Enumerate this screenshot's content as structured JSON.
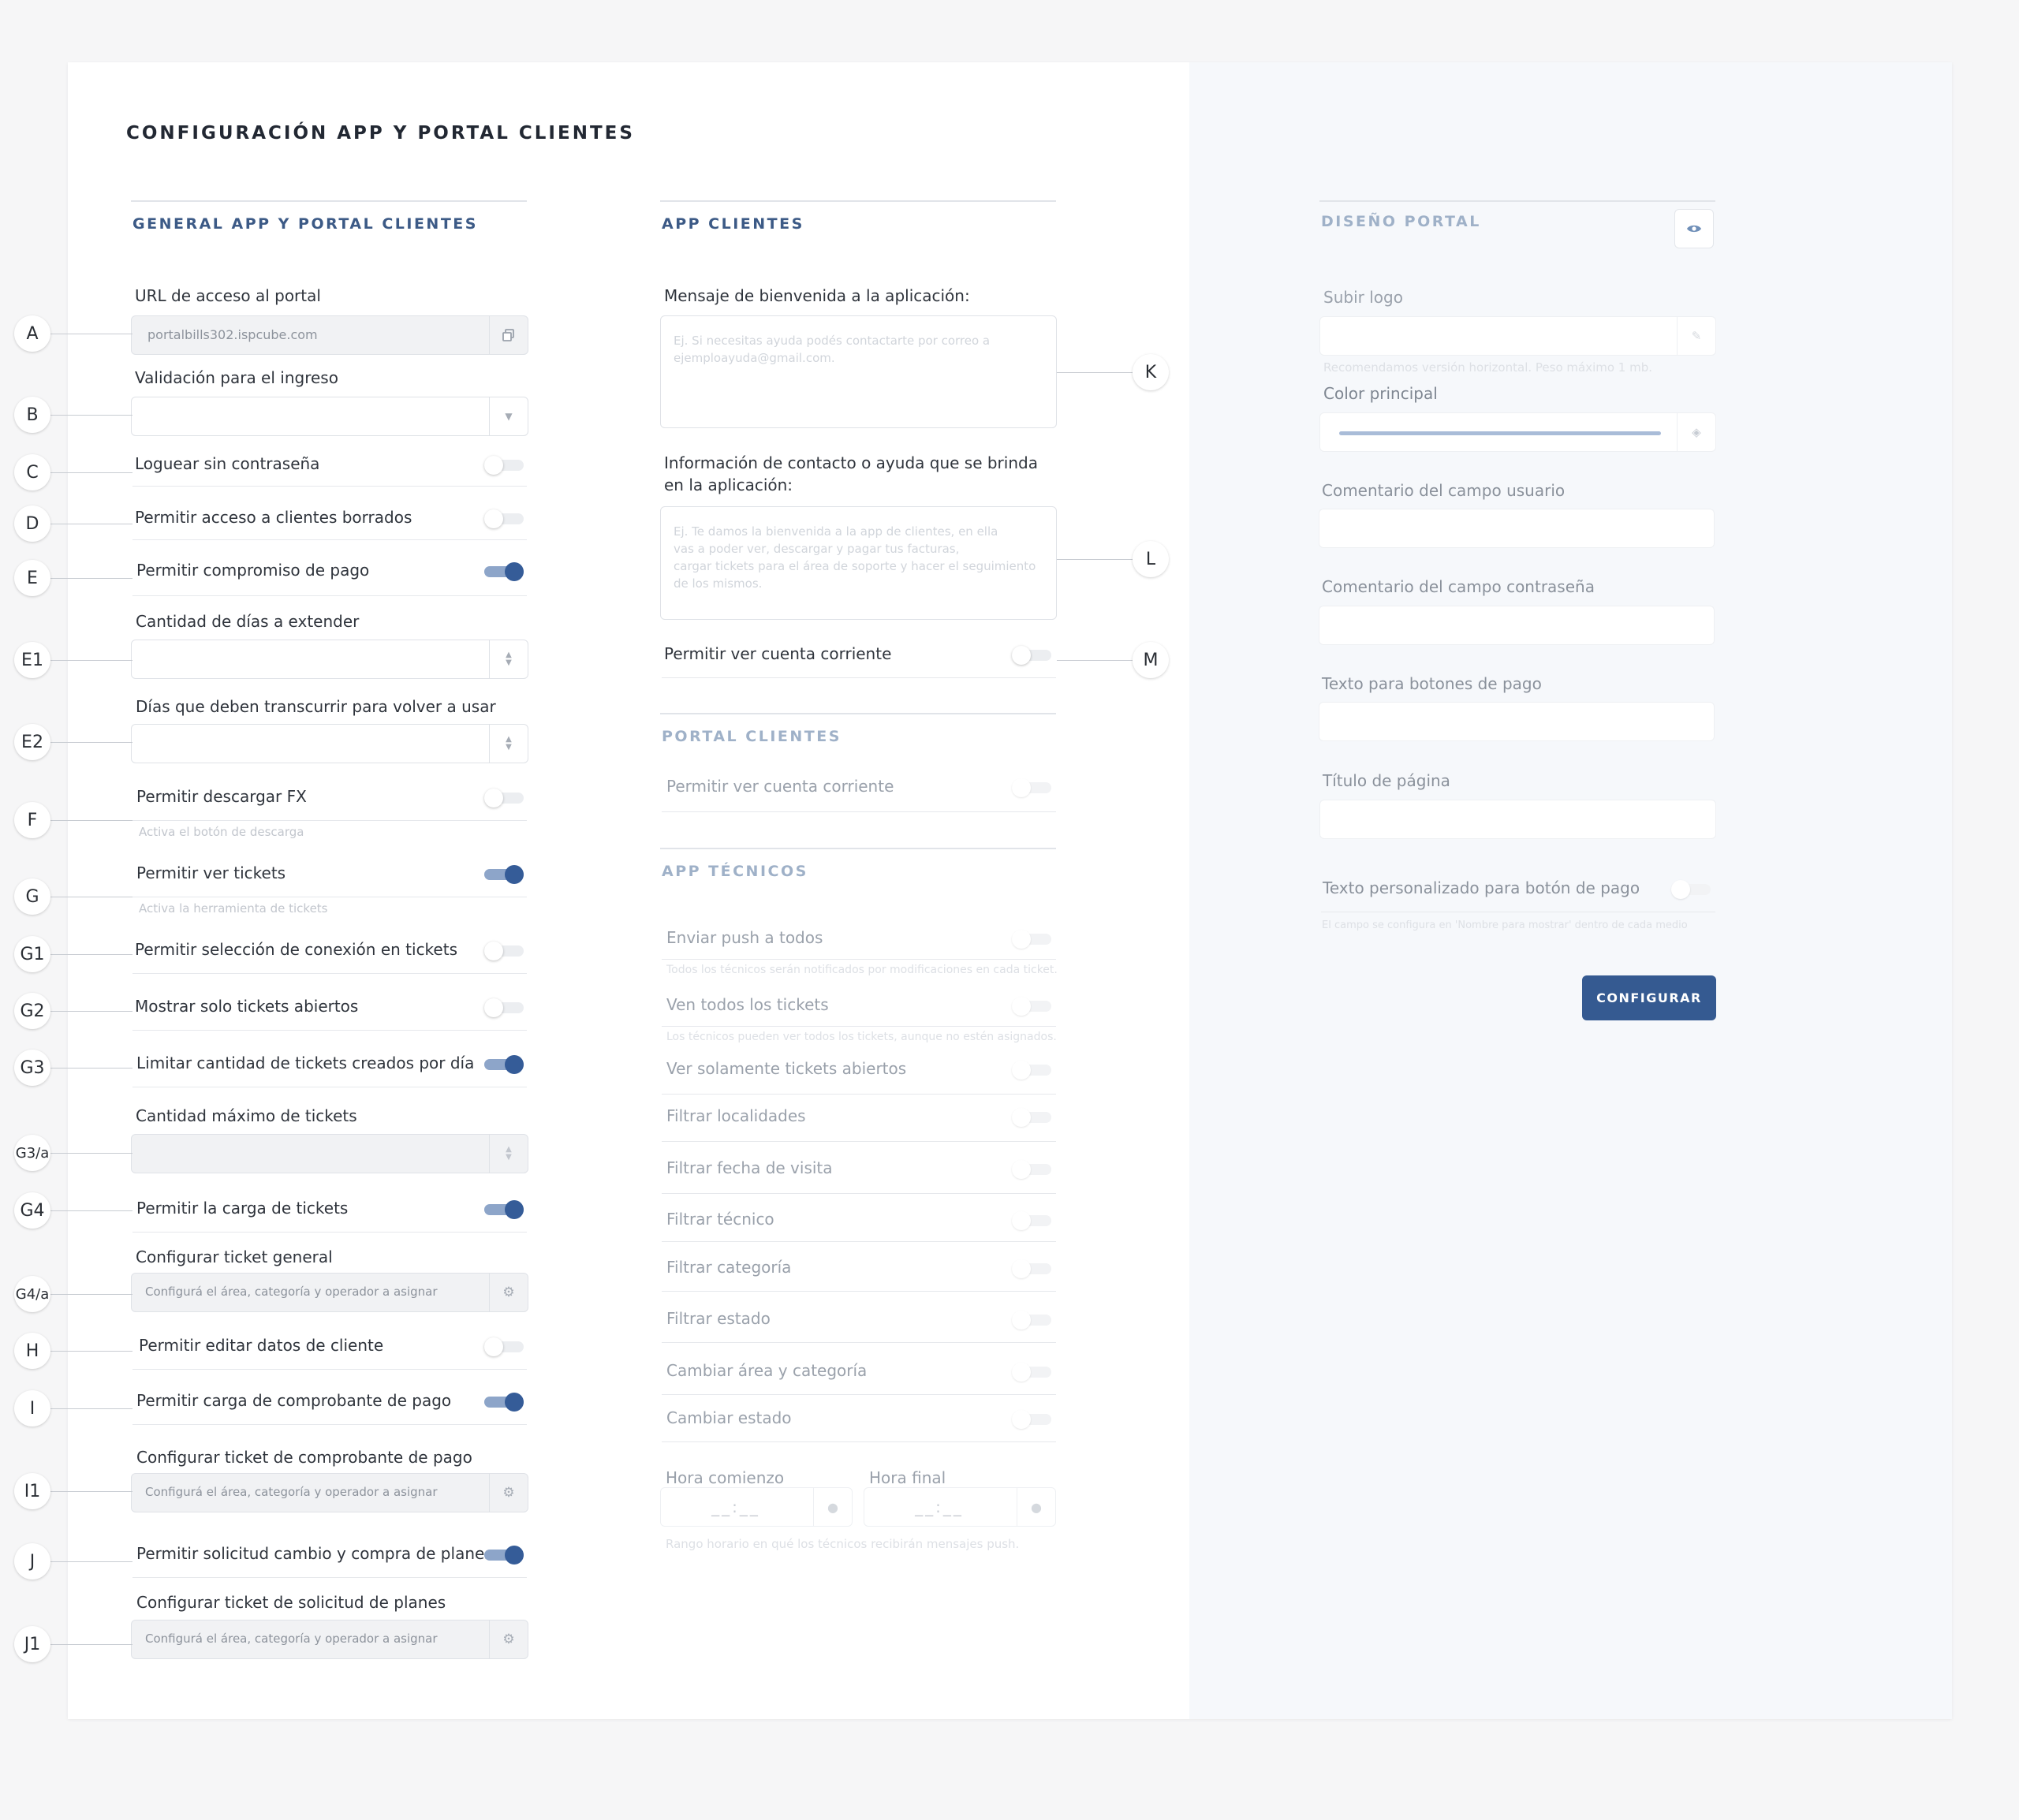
{
  "page": {
    "title": "CONFIGURACIÓN APP Y PORTAL CLIENTES"
  },
  "general": {
    "title": "GENERAL APP Y PORTAL CLIENTES",
    "url_label": "URL de acceso al portal",
    "url_value": "portalbills302.ispcube.com",
    "validation_label": "Validación para el ingreso",
    "validation_value": "",
    "login_no_pass": "Loguear sin contraseña",
    "allow_deleted": "Permitir acceso a clientes borrados",
    "allow_payment_commit": "Permitir compromiso de pago",
    "days_extend_label": "Cantidad de días a extender",
    "days_reuse_label": "Días que deben transcurrir para volver a usar",
    "allow_fx": "Permitir descargar FX",
    "allow_fx_help": "Activa el botón de descarga",
    "allow_tickets": "Permitir ver tickets",
    "allow_tickets_help": "Activa la herramienta de tickets",
    "allow_conn_select": "Permitir selección de conexión en tickets",
    "only_open": "Mostrar solo tickets abiertos",
    "limit_tickets": "Limitar cantidad de tickets creados por día",
    "max_tickets_label": "Cantidad máximo de tickets",
    "allow_ticket_upload": "Permitir la carga de tickets",
    "config_general_ticket": "Configurar ticket general",
    "config_placeholder": "Configurá el área, categoría y operador a asignar",
    "allow_edit_client": "Permitir editar datos de cliente",
    "allow_receipt_upload": "Permitir carga de comprobante de pago",
    "config_receipt_ticket": "Configurar ticket de comprobante de pago",
    "allow_plan_request": "Permitir solicitud cambio y compra de planes",
    "config_plan_ticket": "Configurar ticket de solicitud de planes"
  },
  "app": {
    "title": "APP CLIENTES",
    "welcome_label": "Mensaje de bienvenida a la aplicación:",
    "welcome_placeholder": "Ej. Si necesitas ayuda podés contactarte por correo a\nejemploayuda@gmail.com.",
    "contact_label_1": "Información de contacto o ayuda que se brinda",
    "contact_label_2": "en la aplicación:",
    "contact_placeholder": "Ej. Te damos la bienvenida a la app de clientes, en ella\nvas a poder ver, descargar y pagar tus facturas,\ncargar tickets para el área de soporte y hacer el seguimiento\nde los mismos.",
    "allow_account": "Permitir ver cuenta corriente"
  },
  "portal": {
    "title": "PORTAL CLIENTES",
    "allow_account": "Permitir ver cuenta corriente"
  },
  "tech": {
    "title": "APP TÉCNICOS",
    "push_all": "Enviar push a todos",
    "push_all_help": "Todos los técnicos serán notificados por modificaciones en cada ticket.",
    "see_all": "Ven todos los tickets",
    "see_all_help": "Los técnicos pueden ver todos los tickets, aunque no estén asignados.",
    "only_open": "Ver solamente tickets abiertos",
    "filter_loc": "Filtrar localidades",
    "filter_date": "Filtrar fecha de visita",
    "filter_tech": "Filtrar técnico",
    "filter_cat": "Filtrar categoría",
    "filter_state": "Filtrar estado",
    "change_area": "Cambiar área y categoría",
    "change_state": "Cambiar estado",
    "start_label": "Hora comienzo",
    "end_label": "Hora final",
    "time_placeholder": "__:__",
    "time_help": "Rango horario en qué los técnicos recibirán mensajes push."
  },
  "design": {
    "title": "DISEÑO PORTAL",
    "logo_label": "Subir logo",
    "logo_help": "Recomendamos versión horizontal. Peso máximo 1 mb.",
    "color_label": "Color principal",
    "color_value": "#a9bcd8",
    "user_comment": "Comentario del campo usuario",
    "pass_comment": "Comentario del campo contraseña",
    "pay_btn_text": "Texto para botones de pago",
    "page_title": "Título de página",
    "custom_pay_text": "Texto personalizado para botón de pago",
    "custom_pay_help": "El campo se configura en 'Nombre para mostrar' dentro de cada medio",
    "submit": "CONFIGURAR"
  },
  "markers": [
    "A",
    "B",
    "C",
    "D",
    "E",
    "E1",
    "E2",
    "F",
    "G",
    "G1",
    "G2",
    "G3",
    "G3/a",
    "G4",
    "G4/a",
    "H",
    "I",
    "I1",
    "J",
    "J1",
    "K",
    "L",
    "M"
  ],
  "colors": {
    "accent": "#355a91",
    "toggle_on": "#355c98",
    "muted_title": "#9fb1c8"
  }
}
